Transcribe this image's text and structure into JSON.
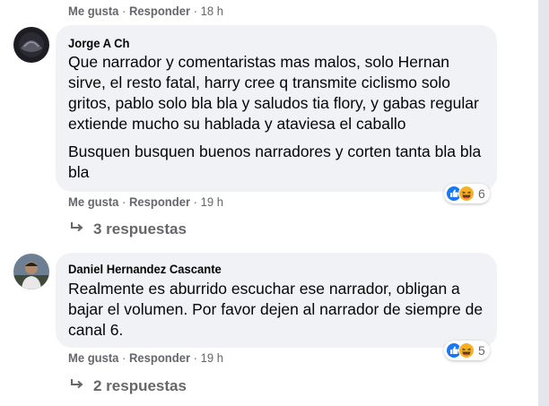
{
  "prev_comment": {
    "like": "Me gusta",
    "reply": "Responder",
    "time": "18 h"
  },
  "comments": [
    {
      "author": "Jorge A Ch",
      "paragraphs": [
        "Que narrador y comentaristas mas malos, solo Hernan sirve, el resto fatal, harry cree q transmite ciclismo solo gritos, pablo solo bla bla y saludos tia flory, y gabas regular extiende mucho su hablada y ataviesa el caballo",
        "Busquen busquen buenos narradores y corten tanta bla bla bla"
      ],
      "reaction_icons": [
        "like-icon",
        "haha-icon"
      ],
      "reaction_count": "6",
      "like": "Me gusta",
      "reply": "Responder",
      "time": "19 h",
      "replies_label": "3 respuestas"
    },
    {
      "author": "Daniel Hernandez Cascante",
      "paragraphs": [
        "Realmente es aburrido escuchar ese narrador, obligan a bajar el volumen. Por favor dejen al narrador de siempre de canal 6."
      ],
      "reaction_icons": [
        "like-icon",
        "haha-icon"
      ],
      "reaction_count": "5",
      "like": "Me gusta",
      "reply": "Responder",
      "time": "19 h",
      "replies_label": "2 respuestas"
    }
  ],
  "colors": {
    "bubble": "#f0f2f5",
    "meta_text": "#65676b",
    "like_blue": "#1877f2",
    "haha_yellow": "#f7b125"
  }
}
